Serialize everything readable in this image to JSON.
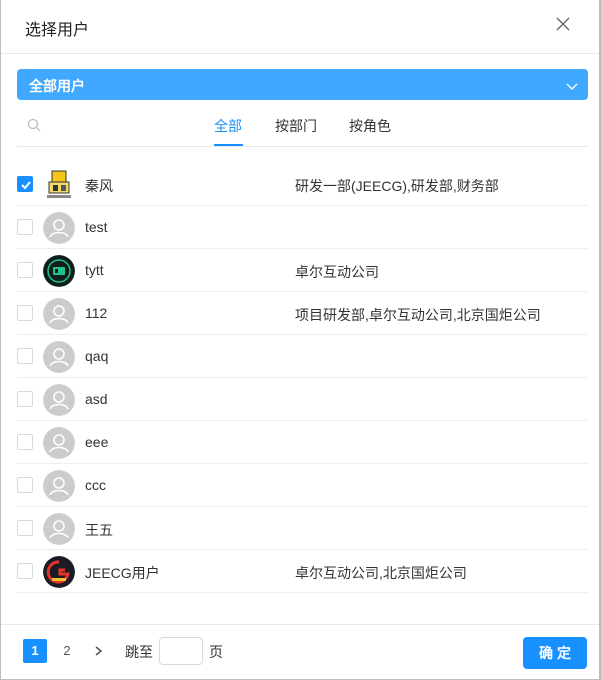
{
  "dialog": {
    "title": "选择用户"
  },
  "department_select": {
    "value": "全部用户"
  },
  "tabs": [
    {
      "label": "全部",
      "active": true
    },
    {
      "label": "按部门",
      "active": false
    },
    {
      "label": "按角色",
      "active": false
    }
  ],
  "users": [
    {
      "name": "秦风",
      "department": "研发一部(JEECG),研发部,财务部",
      "checked": true,
      "avatar": "custom-avatar-yellow"
    },
    {
      "name": "test",
      "department": "",
      "checked": false,
      "avatar": "default-user-icon"
    },
    {
      "name": "tytt",
      "department": "卓尔互动公司",
      "checked": false,
      "avatar": "custom-avatar-green"
    },
    {
      "name": "112",
      "department": "项目研发部,卓尔互动公司,北京国炬公司",
      "checked": false,
      "avatar": "default-user-icon"
    },
    {
      "name": "qaq",
      "department": "",
      "checked": false,
      "avatar": "default-user-icon"
    },
    {
      "name": "asd",
      "department": "",
      "checked": false,
      "avatar": "default-user-icon"
    },
    {
      "name": "eee",
      "department": "",
      "checked": false,
      "avatar": "default-user-icon"
    },
    {
      "name": "ccc",
      "department": "",
      "checked": false,
      "avatar": "default-user-icon"
    },
    {
      "name": "王五",
      "department": "",
      "checked": false,
      "avatar": "default-user-icon"
    },
    {
      "name": "JEECG用户",
      "department": "卓尔互动公司,北京国炬公司",
      "checked": false,
      "avatar": "custom-avatar-dark"
    }
  ],
  "pagination": {
    "pages": [
      "1",
      "2"
    ],
    "current_page": 1,
    "jump_label": "跳至",
    "jump_value": "",
    "page_suffix": "页"
  },
  "footer": {
    "confirm_label": "确定"
  },
  "colors": {
    "primary": "#1890ff",
    "select_bg": "#40a9ff",
    "avatar_gray": "#cccccc"
  }
}
